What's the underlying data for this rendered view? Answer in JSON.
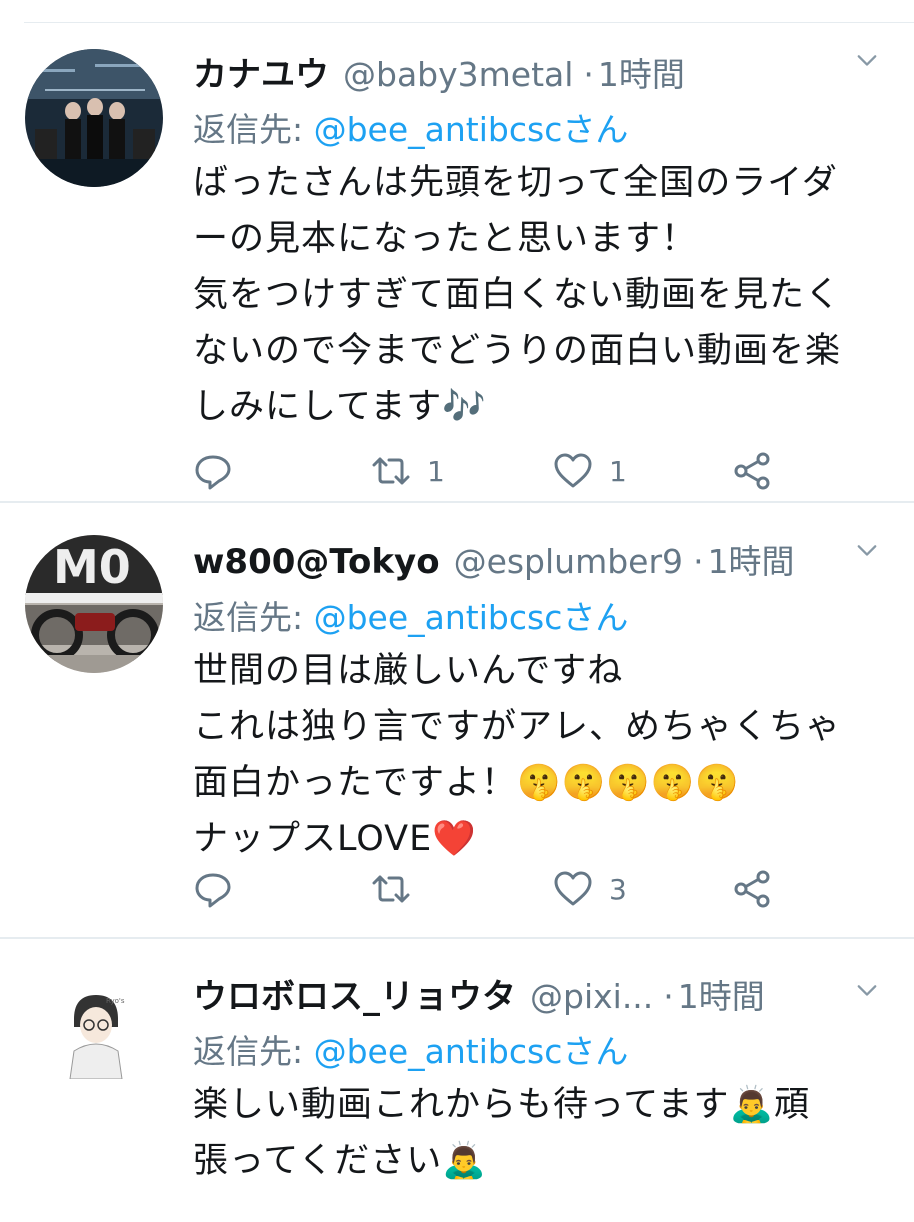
{
  "tweets": [
    {
      "name": "カナユウ",
      "handle": "@baby3metal",
      "separator": "·",
      "time": "1時間",
      "reply_prefix": "返信先: ",
      "reply_to": "@bee_antibcscさん",
      "lines": [
        "ばったさんは先頭を切って全国のライダ",
        "ーの見本になったと思います！",
        "気をつけすぎて面白くない動画を見たく",
        "ないので今までどうりの面白い動画を楽",
        "しみにしてます🎶"
      ],
      "retweets": "1",
      "likes": "1"
    },
    {
      "name": "w800@Tokyo",
      "handle": "@esplumber9",
      "separator": "·",
      "time": "1時間",
      "reply_prefix": "返信先: ",
      "reply_to": "@bee_antibcscさん",
      "lines": [
        "世間の目は厳しいんですね",
        "これは独り言ですがアレ、めちゃくちゃ",
        "面白かったですよ！🤫🤫🤫🤫🤫",
        "ナップスLOVE❤️"
      ],
      "retweets": "",
      "likes": "3"
    },
    {
      "name": "ウロボロス_リョウタ",
      "handle": "@pixi...",
      "separator": "·",
      "time": "1時間",
      "reply_prefix": "返信先: ",
      "reply_to": "@bee_antibcscさん",
      "lines": [
        "楽しい動画これからも待ってます🙇‍♂️頑",
        "張ってください🙇‍♂️"
      ]
    }
  ],
  "colors": {
    "link": "#1da1f2",
    "muted": "#657786",
    "divider": "#e6ecf0"
  },
  "icons": [
    "reply-icon",
    "retweet-icon",
    "like-icon",
    "share-icon",
    "chevron-down-icon"
  ]
}
